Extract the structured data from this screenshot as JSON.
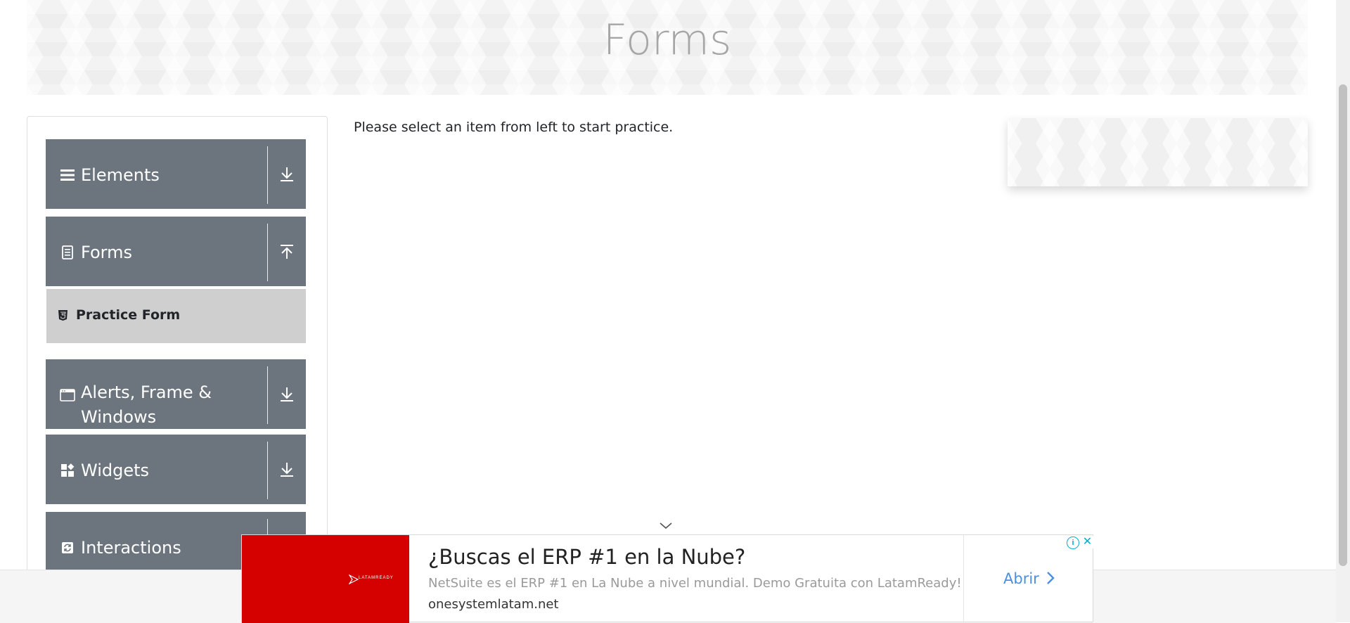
{
  "banner": {
    "title": "Forms"
  },
  "sidebar": {
    "groups": [
      {
        "label": "Elements",
        "icon": "hamburger-icon",
        "toggle": "download-arrow-icon",
        "expanded": false
      },
      {
        "label": "Forms",
        "icon": "document-icon",
        "toggle": "upload-arrow-icon",
        "expanded": true
      },
      {
        "label": "Alerts, Frame & Windows",
        "icon": "window-icon",
        "toggle": "download-arrow-icon",
        "expanded": false
      },
      {
        "label": "Widgets",
        "icon": "widgets-icon",
        "toggle": "download-arrow-icon",
        "expanded": false
      },
      {
        "label": "Interactions",
        "icon": "interactions-icon",
        "toggle": "download-arrow-icon",
        "expanded": false
      }
    ],
    "forms_items": [
      {
        "label": "Practice Form",
        "icon": "html5-icon"
      }
    ]
  },
  "main": {
    "instruction": "Please select an item from left to start practice."
  },
  "ad": {
    "brand": "LATAMREADY",
    "headline": "¿Buscas el ERP #1 en la Nube?",
    "description": "NetSuite es el ERP #1 en La Nube a nivel mundial. Demo Gratuita con LatamReady!",
    "domain": "onesystemlatam.net",
    "cta": "Abrir",
    "info_symbol": "i",
    "close_symbol": "✕",
    "colors": {
      "logo_bg": "#d50000",
      "cta": "#4a90e2",
      "controls": "#00aecd"
    }
  },
  "colors": {
    "sidebar_group_bg": "#6c757d",
    "sidebar_subitem_bg": "#cfcfcf",
    "banner_title": "#a6a6a6"
  }
}
